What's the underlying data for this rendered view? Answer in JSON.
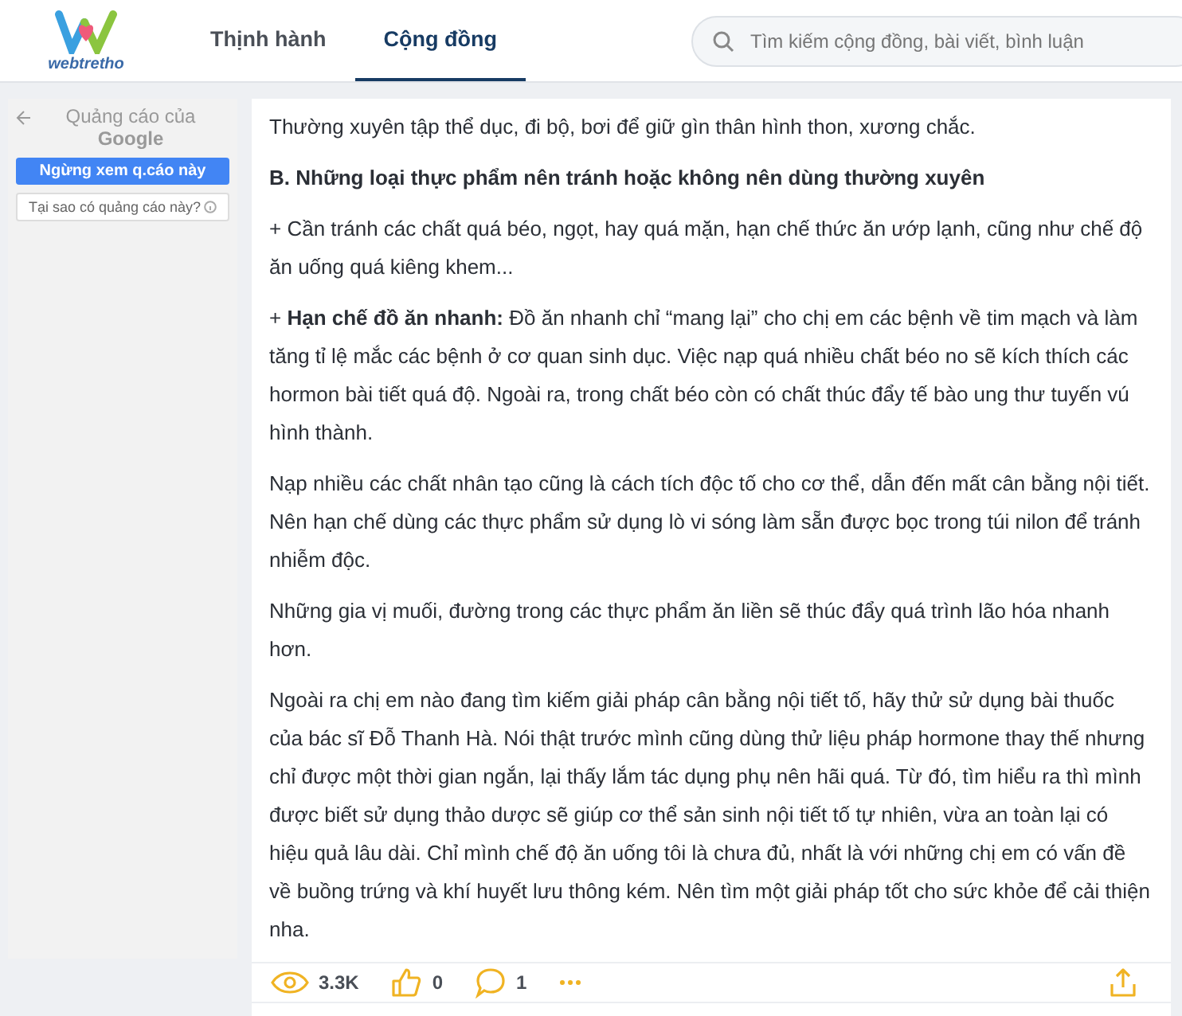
{
  "header": {
    "logo_text": "webtretho",
    "tabs": [
      {
        "label": "Thịnh hành",
        "selected": false
      },
      {
        "label": "Cộng đồng",
        "selected": true
      }
    ],
    "search": {
      "placeholder": "Tìm kiếm cộng đồng, bài viết, bình luận"
    }
  },
  "ad": {
    "title": "Quảng cáo của",
    "brand": "Google",
    "stop_button": "Ngừng xem q.cáo này",
    "why_button": "Tại sao có quảng cáo này?"
  },
  "article": {
    "paragraphs": [
      {
        "kind": "text",
        "text": "Thường xuyên tập thể dục, đi bộ, bơi để giữ gìn thân hình thon, xương chắc."
      },
      {
        "kind": "heading",
        "text": "B. Những loại thực phẩm nên tránh hoặc không nên dùng thường xuyên"
      },
      {
        "kind": "text",
        "text": "+ Cần tránh các chất quá béo, ngọt, hay quá mặn, hạn chế thức ăn ướp lạnh, cũng như chế độ ăn uống quá kiêng khem..."
      },
      {
        "kind": "text",
        "text": "+ **Hạn chế đồ ăn nhanh:** Đồ ăn nhanh chỉ “mang lại” cho chị em các bệnh về tim mạch và làm tăng tỉ lệ mắc các bệnh ở cơ quan sinh dục. Việc nạp quá nhiều chất béo no sẽ kích thích các hormon bài tiết quá độ. Ngoài ra, trong chất béo còn có chất thúc đẩy tế bào ung thư tuyến vú hình thành."
      },
      {
        "kind": "text",
        "text": "Nạp nhiều các chất nhân tạo cũng là cách tích độc tố cho cơ thể, dẫn đến mất cân bằng nội tiết. Nên hạn chế dùng các thực phẩm sử dụng lò vi sóng làm sẵn được bọc trong túi nilon để tránh nhiễm độc."
      },
      {
        "kind": "text",
        "text": "Những gia vị muối, đường trong các thực phẩm ăn liền sẽ thúc đẩy quá trình lão hóa nhanh hơn."
      },
      {
        "kind": "text",
        "text": "Ngoài ra chị em nào đang tìm kiếm giải pháp cân bằng nội tiết tố, hãy thử sử dụng bài thuốc của bác sĩ Đỗ Thanh Hà. Nói thật trước mình cũng dùng thử liệu pháp hormone thay thế nhưng chỉ được một thời gian ngắn, lại thấy lắm tác dụng phụ nên hãi quá. Từ đó, tìm hiểu ra thì mình được biết sử dụng thảo dược sẽ giúp cơ thể sản sinh nội tiết tố tự nhiên, vừa an toàn lại có hiệu quả lâu dài. Chỉ mình chế độ ăn uống tôi là chưa đủ, nhất là với những chị em có vấn đề về buồng trứng và khí huyết lưu thông kém. Nên tìm một giải pháp tốt cho sức khỏe để cải thiện nha."
      }
    ],
    "stats": {
      "views": "3.3K",
      "likes": "0",
      "comments": "1"
    }
  }
}
